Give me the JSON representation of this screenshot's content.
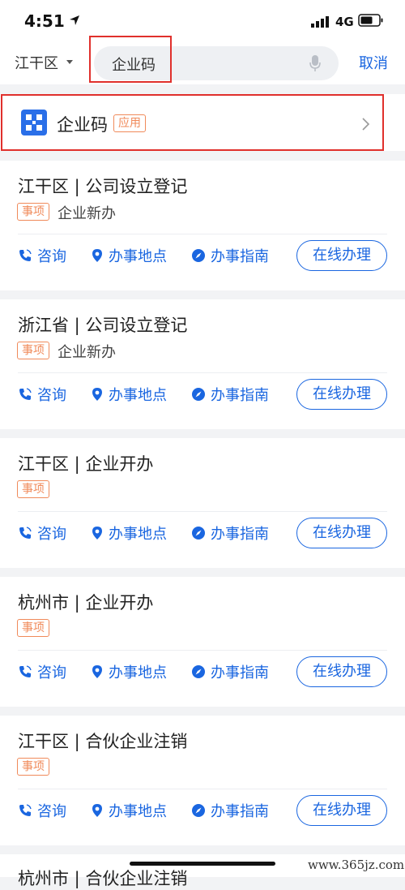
{
  "status": {
    "time": "4:51",
    "network": "4G"
  },
  "search": {
    "region": "江干区",
    "query": "企业码",
    "cancel": "取消"
  },
  "app_result": {
    "name": "企业码",
    "tag": "应用"
  },
  "items": [
    {
      "title": "江干区 | 公司设立登记",
      "tag": "事项",
      "subtitle": "企业新办"
    },
    {
      "title": "浙江省 | 公司设立登记",
      "tag": "事项",
      "subtitle": "企业新办"
    },
    {
      "title": "江干区 | 企业开办",
      "tag": "事项",
      "subtitle": ""
    },
    {
      "title": "杭州市 | 企业开办",
      "tag": "事项",
      "subtitle": ""
    },
    {
      "title": "江干区 | 合伙企业注销",
      "tag": "事项",
      "subtitle": ""
    }
  ],
  "actions": {
    "consult": "咨询",
    "location": "办事地点",
    "guide": "办事指南",
    "online": "在线办理"
  },
  "partial_item": {
    "title": "杭州市 | 合伙企业注销"
  },
  "watermark": "www.365jz.com",
  "colors": {
    "accent": "#1a66e0",
    "tag": "#f08a5a",
    "highlight": "#e0302c",
    "background": "#f2f3f5"
  }
}
